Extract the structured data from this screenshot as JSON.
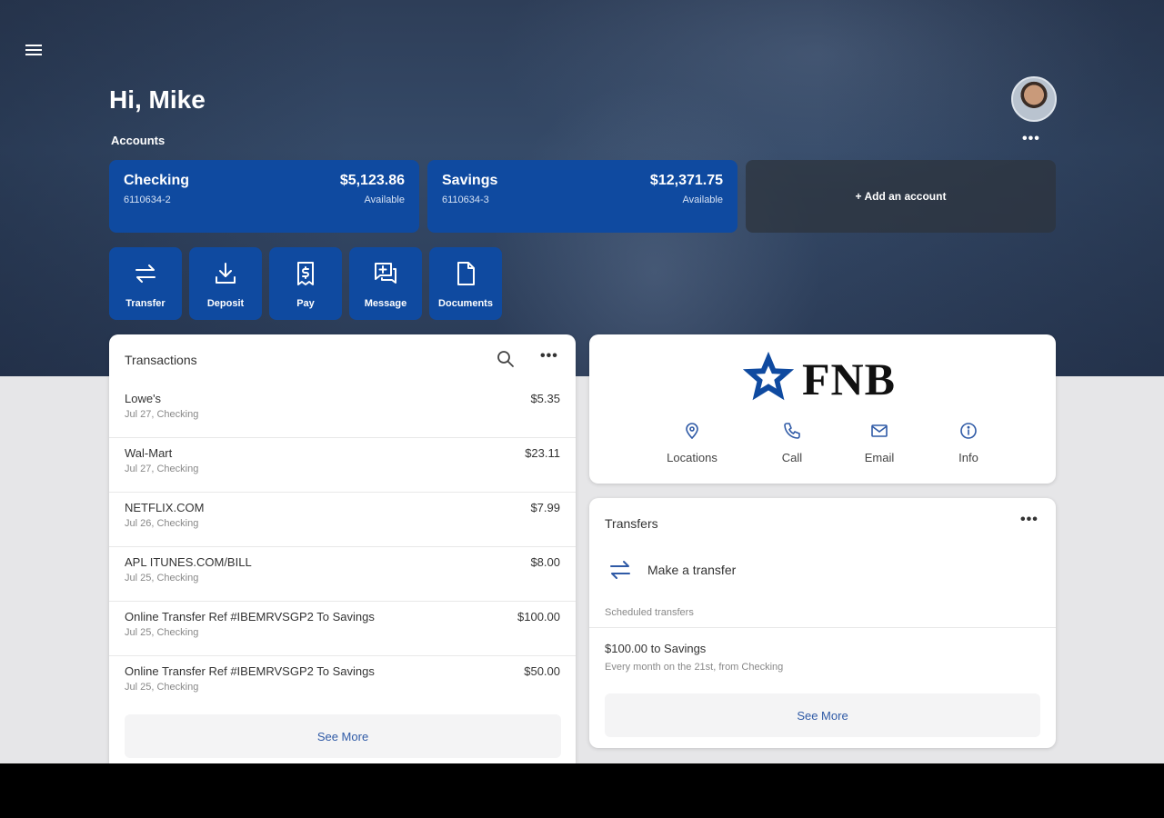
{
  "header": {
    "greeting": "Hi, Mike",
    "accounts_label": "Accounts",
    "more_glyph": "•••"
  },
  "accounts": [
    {
      "name": "Checking",
      "number": "6110634-2",
      "balance": "$5,123.86",
      "status": "Available"
    },
    {
      "name": "Savings",
      "number": "6110634-3",
      "balance": "$12,371.75",
      "status": "Available"
    }
  ],
  "add_account_label": "+ Add an account",
  "quick_actions": [
    {
      "label": "Transfer",
      "icon": "transfer-icon"
    },
    {
      "label": "Deposit",
      "icon": "deposit-icon"
    },
    {
      "label": "Pay",
      "icon": "pay-icon"
    },
    {
      "label": "Message",
      "icon": "message-icon"
    },
    {
      "label": "Documents",
      "icon": "document-icon"
    }
  ],
  "transactions": {
    "title": "Transactions",
    "items": [
      {
        "merchant": "Lowe's",
        "detail": "Jul 27, Checking",
        "amount": "$5.35"
      },
      {
        "merchant": "Wal-Mart",
        "detail": "Jul 27, Checking",
        "amount": "$23.11"
      },
      {
        "merchant": "NETFLIX.COM",
        "detail": "Jul 26, Checking",
        "amount": "$7.99"
      },
      {
        "merchant": "APL ITUNES.COM/BILL",
        "detail": "Jul 25, Checking",
        "amount": "$8.00"
      },
      {
        "merchant": "Online Transfer Ref #IBEMRVSGP2 To Savings",
        "detail": "Jul 25, Checking",
        "amount": "$100.00"
      },
      {
        "merchant": "Online Transfer Ref #IBEMRVSGP2 To Savings",
        "detail": "Jul 25, Checking",
        "amount": "$50.00"
      }
    ],
    "see_more": "See More"
  },
  "bank": {
    "logo_text": "FNB",
    "brand_color": "#0f4aa0",
    "contacts": [
      {
        "label": "Locations",
        "icon": "location-pin-icon"
      },
      {
        "label": "Call",
        "icon": "phone-icon"
      },
      {
        "label": "Email",
        "icon": "email-icon"
      },
      {
        "label": "Info",
        "icon": "info-icon"
      }
    ]
  },
  "transfers": {
    "title": "Transfers",
    "make_transfer": "Make a transfer",
    "scheduled_label": "Scheduled transfers",
    "scheduled": [
      {
        "title": "$100.00 to Savings",
        "detail": "Every month on the 21st, from Checking"
      }
    ],
    "see_more": "See More"
  }
}
